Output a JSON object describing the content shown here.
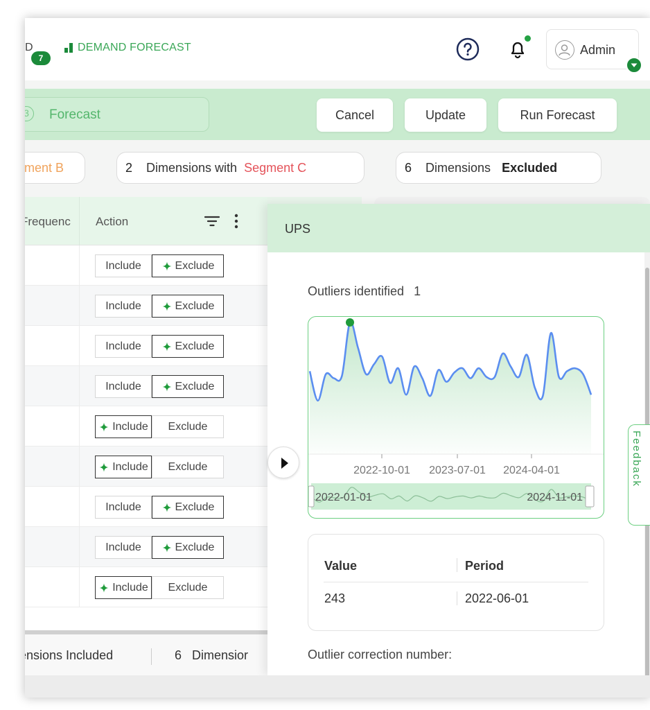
{
  "header": {
    "app_letter": "D",
    "notification_count": "7",
    "brand": "DEMAND FORECAST",
    "user_name": "Admin",
    "colors": {
      "brand_green": "#1b8a3a",
      "accent_green": "#3aa757"
    }
  },
  "stepbar": {
    "step_number": "3",
    "step_label": "Forecast",
    "buttons": {
      "cancel": "Cancel",
      "update": "Update",
      "run_forecast": "Run Forecast"
    }
  },
  "segments": {
    "chip_b": {
      "label": "ment B"
    },
    "chip_c": {
      "count": "2",
      "text": "Dimensions with",
      "segment": "Segment C"
    },
    "chip_excluded": {
      "count": "6",
      "text": "Dimensions",
      "status": "Excluded"
    }
  },
  "table": {
    "col_frequency": "Frequenc",
    "col_action": "Action",
    "include_label": "Include",
    "exclude_label": "Exclude",
    "rows": [
      {
        "active": "Exclude"
      },
      {
        "active": "Exclude"
      },
      {
        "active": "Exclude"
      },
      {
        "active": "Exclude"
      },
      {
        "active": "Include"
      },
      {
        "active": "Include"
      },
      {
        "active": "Exclude"
      },
      {
        "active": "Exclude"
      },
      {
        "active": "Include"
      }
    ]
  },
  "footer": {
    "included": "ensions Included",
    "dimensions_count": "6",
    "dimensions_text": "Dimensior"
  },
  "drawer": {
    "title": "UPS",
    "outliers_label": "Outliers identified",
    "outliers_count": "1",
    "detail": {
      "value_header": "Value",
      "period_header": "Period",
      "value": "243",
      "period": "2022-06-01"
    },
    "correction_label": "Outlier correction number:"
  },
  "feedback_label": "Feedback",
  "chart_data": {
    "type": "area",
    "x_ticks": [
      "2022-10-01",
      "2023-07-01",
      "2024-04-01"
    ],
    "range_start": "2022-01-01",
    "range_end": "2024-11-01",
    "outlier": {
      "x": "2022-06-01",
      "y": 243
    },
    "series_values": [
      160,
      110,
      155,
      148,
      152,
      243,
      200,
      155,
      172,
      185,
      140,
      165,
      120,
      168,
      148,
      118,
      162,
      142,
      158,
      165,
      148,
      165,
      150,
      150,
      190,
      168,
      150,
      188,
      132,
      118,
      225,
      150,
      160,
      165,
      155,
      120
    ],
    "colors": {
      "line": "#5b8ef0",
      "area": "#bfe6c8",
      "outlier": "#1f9b3b"
    }
  }
}
